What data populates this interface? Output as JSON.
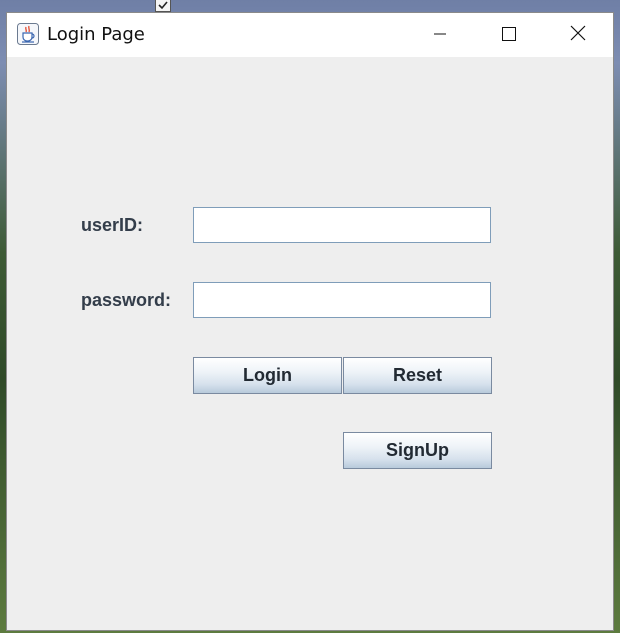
{
  "window": {
    "title": "Login Page",
    "app_icon": "java-coffee-cup-icon",
    "controls": {
      "minimize_icon": "minimize-icon",
      "maximize_icon": "maximize-icon",
      "close_icon": "close-icon"
    }
  },
  "form": {
    "user_label": "userID:",
    "user_value": "",
    "password_label": "password:",
    "password_value": ""
  },
  "buttons": {
    "login": "Login",
    "reset": "Reset",
    "signup": "SignUp"
  },
  "colors": {
    "window_bg": "#eeeeee",
    "titlebar_bg": "#ffffff",
    "label_text": "#333d4a",
    "field_border": "#7f9db9",
    "button_border": "#7a8aa0"
  }
}
